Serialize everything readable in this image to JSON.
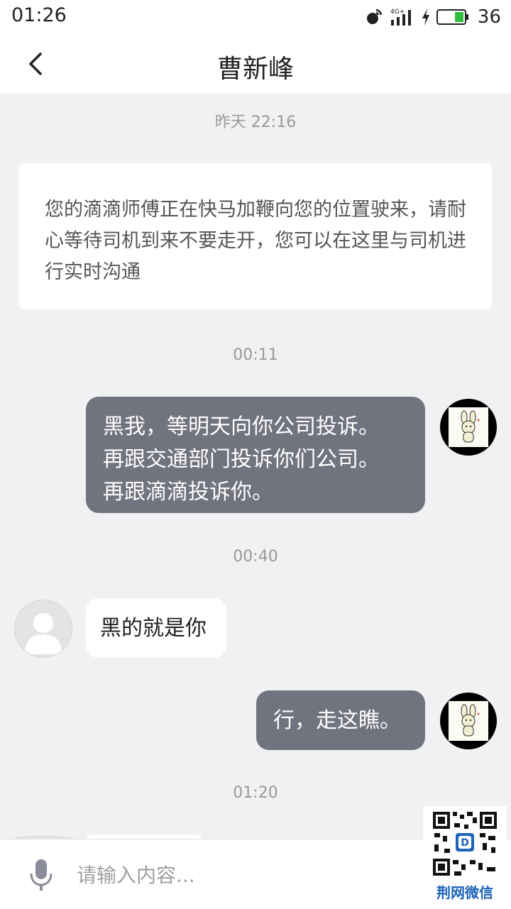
{
  "status_bar": {
    "time": "01:26",
    "network": "4G+",
    "battery_percent": "36",
    "icons": [
      "signal-broadcast-icon",
      "cellular-signal-icon",
      "charging-bolt-icon",
      "battery-icon"
    ]
  },
  "header": {
    "back_icon": "chevron-left-icon",
    "title": "曹新峰"
  },
  "messages": {
    "timestamp_1": "昨天 22:16",
    "system_notice": "您的滴滴师傅正在快马加鞭向您的位置驶来，请耐心等待司机到来不要走开，您可以在这里与司机进行实时沟通",
    "timestamp_2": "00:11",
    "out_1": {
      "line_1": "黑我，等明天向你公司投诉。",
      "line_2": "再跟交通部门投诉你们公司。",
      "line_3": "再跟滴滴投诉你。"
    },
    "timestamp_3": "00:40",
    "in_1": "黑的就是你",
    "out_2": "行，走这瞧。",
    "timestamp_4": "01:20"
  },
  "input_bar": {
    "mic_icon": "microphone-icon",
    "placeholder": "请输入内容..."
  },
  "watermark": {
    "label": "荆网微信",
    "icon": "qr-code-icon"
  },
  "colors": {
    "outgoing_bubble": "#71737f",
    "incoming_bubble": "#ffffff",
    "background": "#f0f1f3",
    "watermark_text": "#1d63b8"
  }
}
